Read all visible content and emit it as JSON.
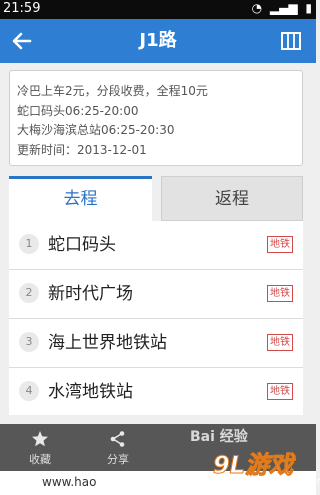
{
  "status_bar": {
    "time": "21:59"
  },
  "app_bar": {
    "title": "J1路"
  },
  "route_info": {
    "lines": [
      "冷巴上车2元，分段收费，全程10元",
      "蛇口码头06:25-20:00",
      "大梅沙海滨总站06:25-20:30",
      "更新时间：2013-12-01"
    ]
  },
  "tabs": {
    "outbound": "去程",
    "return": "返程"
  },
  "stops": [
    {
      "num": "1",
      "name": "蛇口码头",
      "badge": "地铁"
    },
    {
      "num": "2",
      "name": "新时代广场",
      "badge": "地铁"
    },
    {
      "num": "3",
      "name": "海上世界地铁站",
      "badge": "地铁"
    },
    {
      "num": "4",
      "name": "水湾地铁站",
      "badge": "地铁"
    }
  ],
  "bottom_bar": {
    "favorite_label": "收藏",
    "share_label": "分享",
    "watermark_text": "Bai 经验"
  },
  "overlay": {
    "logo_text": "9L游戏",
    "logo_url": "91danji.com",
    "footer_url": "www.hao"
  }
}
